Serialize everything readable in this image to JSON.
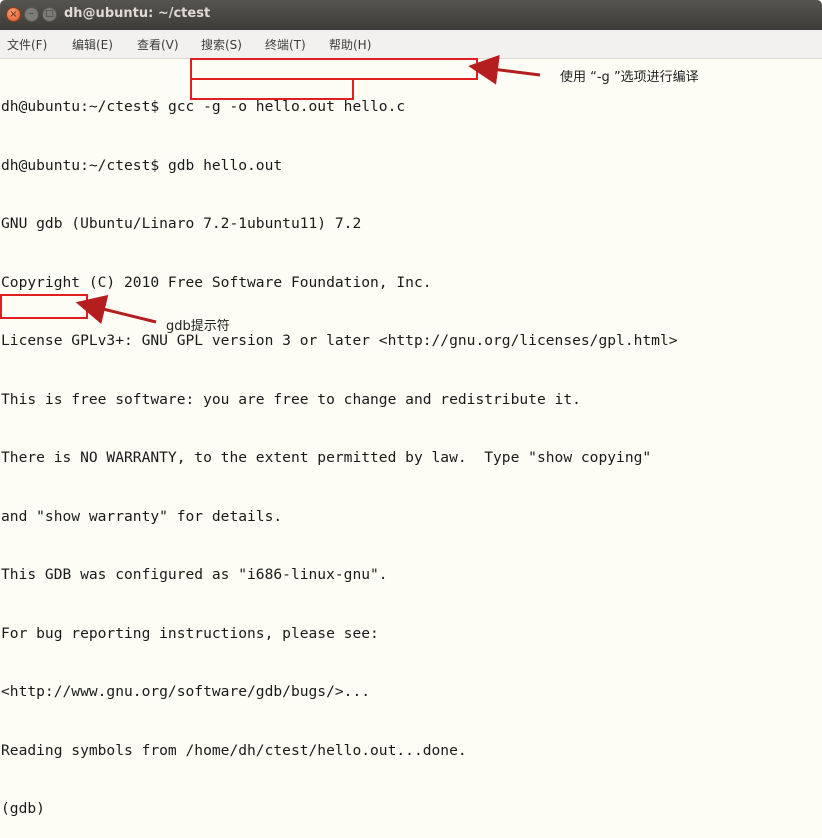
{
  "window": {
    "title": "dh@ubuntu: ~/ctest",
    "close_glyph": "×",
    "min_glyph": "–",
    "max_glyph": "□"
  },
  "menu": [
    "文件(F)",
    "编辑(E)",
    "查看(V)",
    "搜索(S)",
    "终端(T)",
    "帮助(H)"
  ],
  "terminal": {
    "prompt": "dh@ubuntu:~/ctest$ ",
    "cmd1": "gcc -g -o hello.out hello.c",
    "cmd2": "gdb hello.out",
    "output": [
      "GNU gdb (Ubuntu/Linaro 7.2-1ubuntu11) 7.2",
      "Copyright (C) 2010 Free Software Foundation, Inc.",
      "License GPLv3+: GNU GPL version 3 or later <http://gnu.org/licenses/gpl.html>",
      "This is free software: you are free to change and redistribute it.",
      "There is NO WARRANTY, to the extent permitted by law.  Type \"show copying\"",
      "and \"show warranty\" for details.",
      "This GDB was configured as \"i686-linux-gnu\".",
      "For bug reporting instructions, please see:",
      "<http://www.gnu.org/software/gdb/bugs/>...",
      "Reading symbols from /home/dh/ctest/hello.out...done."
    ],
    "gdb_prompt": "(gdb)"
  },
  "annotations": {
    "g_option": "使用 “-g ”选项进行编译",
    "gdb_prompt": "gdb提示符"
  },
  "colors": {
    "highlight": "#e02020",
    "arrow": "#b41e1e",
    "terminal_bg": "#fdfdf6"
  }
}
